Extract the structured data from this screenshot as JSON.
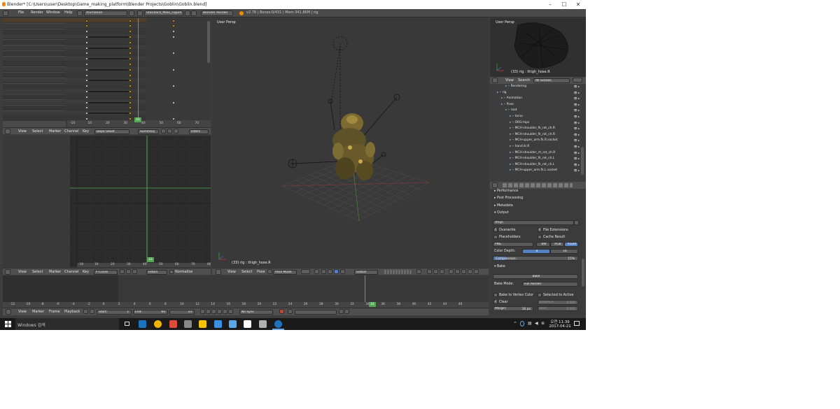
{
  "window": {
    "title": "Blender* [C:\\Users\\user\\Desktop\\Game_making_platform\\Blender Projects\\Goblin\\Goblin.blend]",
    "controls": {
      "minimize": "–",
      "maximize": "☐",
      "close": "✕"
    }
  },
  "menubar": {
    "items": [
      "File",
      "Render",
      "Window",
      "Help"
    ],
    "screen_layout": "Animation",
    "scene": "Standard_Male_Figure",
    "render_engine": "Blender Render",
    "stats": "v2.78 | Bones:0/431 | Mem:341.86M | rig"
  },
  "dopesheet": {
    "channels": [
      {
        "label": "Dope Sheet Summary",
        "kind": "summary"
      },
      {
        "label": "rig",
        "kind": "obj"
      },
      {
        "label": "rigAction",
        "kind": "act"
      },
      {
        "label": "root"
      },
      {
        "label": "torso"
      },
      {
        "label": "chest"
      },
      {
        "label": "hips"
      },
      {
        "label": "spine"
      },
      {
        "label": "shoulder.L"
      },
      {
        "label": "shoulder.R"
      },
      {
        "label": "hand.ik.R"
      },
      {
        "label": "upper_arm_hose_end.R"
      },
      {
        "label": "hand.ik.L"
      },
      {
        "label": "upper_arm_hose_end.L"
      },
      {
        "label": "head"
      },
      {
        "label": "neck"
      },
      {
        "label": "thigh_hose_end.L"
      },
      {
        "label": "foot.ik.L"
      },
      {
        "label": "foot_roll.ik.L"
      }
    ],
    "ruler": [
      "-10",
      "10",
      "20",
      "30",
      "40",
      "50",
      "60",
      "70",
      "80"
    ],
    "current_frame": "33",
    "header": {
      "menus": [
        "View",
        "Select",
        "Marker",
        "Channel",
        "Key"
      ],
      "mode": "Dope Sheet",
      "summary": "Summary",
      "filters": "Filters"
    }
  },
  "graph_editor": {
    "ruler": [
      "-10",
      "10",
      "20",
      "30",
      "40",
      "50",
      "60",
      "70",
      "80"
    ],
    "current_frame": "33",
    "header": {
      "menus": [
        "View",
        "Select",
        "Marker",
        "Channel",
        "Key"
      ],
      "mode": "F-Curve",
      "filters": "Filters",
      "normalize": "Normalize"
    }
  },
  "viewport": {
    "label": "User Persp",
    "status": "(33) rig : thigh_hose.R",
    "header": {
      "menus": [
        "View",
        "Select",
        "Pose"
      ],
      "mode": "Pose Mode",
      "orientation": "Global"
    }
  },
  "mini_viewport": {
    "label": "User Persp",
    "status": "(33) rig : thigh_hose.R"
  },
  "outliner": {
    "header": {
      "view": "View",
      "search": "Search",
      "scenes": "All Scenes"
    },
    "rows": [
      {
        "label": "Rendering",
        "indent": 3
      },
      {
        "label": "rig",
        "indent": 1
      },
      {
        "label": "Animation",
        "indent": 2
      },
      {
        "label": "Pose",
        "indent": 2
      },
      {
        "label": "root",
        "indent": 3
      },
      {
        "label": "torso",
        "indent": 4
      },
      {
        "label": "ORG-hips",
        "indent": 4
      },
      {
        "label": "MCH-shoulder_fk_rot_ch.R",
        "indent": 4
      },
      {
        "label": "MCH-shoulder_fk_rot_ch.R",
        "indent": 4
      },
      {
        "label": "MCH-upper_arm.fk.R.socket",
        "indent": 4
      },
      {
        "label": "hand.ik.R",
        "indent": 4
      },
      {
        "label": "MCH-shoulder_rh_rot_ch.R",
        "indent": 4
      },
      {
        "label": "MCH-shoulder_fk_rot_ch.L",
        "indent": 4
      },
      {
        "label": "MCH-shoulder_fk_rot_ch.L",
        "indent": 4
      },
      {
        "label": "MCH-upper_arm.fk.L.socket",
        "indent": 4
      }
    ]
  },
  "properties": {
    "panels": [
      "Performance",
      "Post Processing",
      "Metadata",
      "Output"
    ],
    "output_path": "/tmp\\",
    "overwrite": "Overwrite",
    "file_extensions": "File Extensions",
    "placeholders": "Placeholders",
    "cache_result": "Cache Result",
    "format": "PNG",
    "bw": "BW",
    "rgb": "RGB",
    "rgba": "RGBA",
    "color_depth_label": "Color Depth:",
    "depth_8": "8",
    "depth_16": "16",
    "compression_label": "Compression:",
    "compression_value": "15%",
    "compression_fraction": 0.15,
    "bake_panel": "Bake",
    "bake_button": "Bake",
    "bake_mode_label": "Bake Mode:",
    "bake_mode": "Full Render",
    "bake_to_vertex": "Bake to Vertex Color",
    "selected_to_active": "Selected to Active",
    "clear": "Clear",
    "distance": "Distance:",
    "distance_val": "0.000",
    "margin": "Margin:",
    "margin_val": "16 px",
    "bias": "Bias:",
    "bias_val": "0.001"
  },
  "timeline": {
    "ruler": [
      "-12",
      "-10",
      "-8",
      "-6",
      "-4",
      "-2",
      "0",
      "2",
      "4",
      "6",
      "8",
      "10",
      "12",
      "14",
      "16",
      "18",
      "20",
      "22",
      "24",
      "26",
      "28",
      "30",
      "32",
      "34",
      "36",
      "38",
      "40",
      "42",
      "44",
      "46"
    ],
    "current_frame": "33",
    "header": {
      "menus": [
        "View",
        "Marker",
        "Frame",
        "Playback"
      ],
      "start_label": "Start:",
      "start": "1",
      "end_label": "End:",
      "end": "60",
      "current": "33",
      "sync": "No Sync"
    }
  },
  "taskbar": {
    "search": "Windows 검색",
    "time": "오전 11:39",
    "date": "2017-04-21",
    "colors": [
      "#1e73be",
      "#f0b400",
      "#dd4b39",
      "#888888",
      "#f6c500",
      "#3b8ee0",
      "#5aa9e6",
      "#ffffff",
      "#b0b0b0",
      "#1e73be",
      "#ff8c00"
    ]
  }
}
